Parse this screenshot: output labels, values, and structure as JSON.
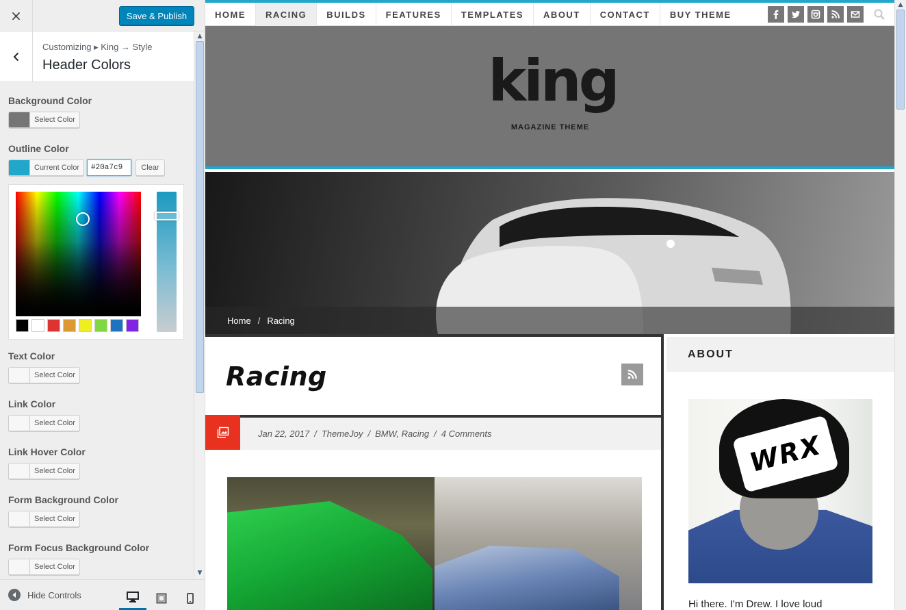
{
  "customizer": {
    "close_label": "×",
    "save_button": "Save & Publish",
    "breadcrumb": "Customizing ▸ King → Style",
    "section_title": "Header Colors",
    "controls": [
      {
        "label": "Background Color",
        "button": "Select Color",
        "swatch": "#757575"
      },
      {
        "label": "Outline Color",
        "button": "Current Color",
        "swatch": "#20a7c9"
      },
      {
        "label": "Text Color",
        "button": "Select Color",
        "swatch": "#f7f7f7"
      },
      {
        "label": "Link Color",
        "button": "Select Color",
        "swatch": "#f7f7f7"
      },
      {
        "label": "Link Hover Color",
        "button": "Select Color",
        "swatch": "#f7f7f7"
      },
      {
        "label": "Form Background Color",
        "button": "Select Color",
        "swatch": "#f7f7f7"
      },
      {
        "label": "Form Focus Background Color",
        "button": "Select Color",
        "swatch": "#f7f7f7"
      }
    ],
    "outline_hex_value": "#20a7c9",
    "clear_button": "Clear",
    "palette": [
      "#000000",
      "#ffffff",
      "#dd3333",
      "#dd9933",
      "#eeee22",
      "#81d742",
      "#1e73be",
      "#8224e3"
    ],
    "hide_controls": "Hide Controls"
  },
  "preview": {
    "nav": [
      "HOME",
      "RACING",
      "BUILDS",
      "FEATURES",
      "TEMPLATES",
      "ABOUT",
      "CONTACT",
      "BUY THEME"
    ],
    "active_nav": "RACING",
    "social_icons": [
      "facebook-icon",
      "twitter-icon",
      "instagram-icon",
      "rss-icon",
      "email-icon"
    ],
    "logo": "king",
    "tagline": "MAGAZINE THEME",
    "breadcrumb": {
      "home": "Home",
      "sep": "/",
      "current": "Racing"
    },
    "page_heading": "Racing",
    "post_meta": {
      "date": "Jan 22, 2017",
      "sep1": "/",
      "author": "ThemeJoy",
      "sep2": "/",
      "categories": "BMW, Racing",
      "sep3": "/",
      "comments": "4 Comments"
    },
    "widget_title": "ABOUT",
    "about_text": "Hi there. I'm Drew. I love loud",
    "cap_text": "WRX"
  },
  "colors": {
    "accent": "#20a7c9",
    "header_bg": "#757575",
    "save_blue": "#0085ba",
    "format_icon_bg": "#e8311e"
  }
}
